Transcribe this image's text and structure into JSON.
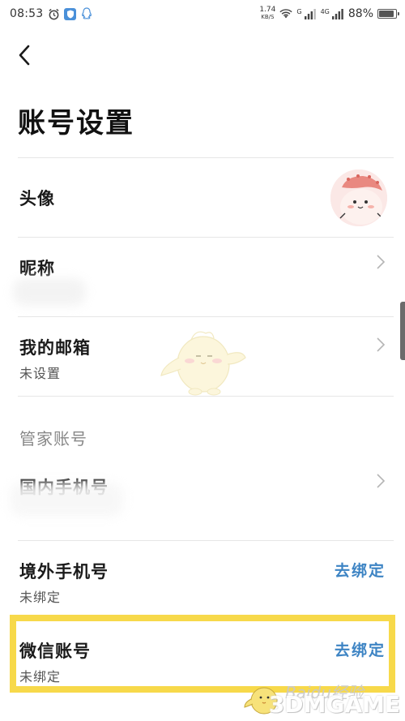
{
  "status_bar": {
    "time": "08:53",
    "net_speed_value": "1.74",
    "net_speed_unit": "KB/S",
    "signal1_label": "G",
    "signal2_label": "4G",
    "battery_percent": "88%",
    "battery_level": 0.88
  },
  "page": {
    "title": "账号设置"
  },
  "rows": {
    "avatar": {
      "title": "头像"
    },
    "nickname": {
      "title": "昵称"
    },
    "email": {
      "title": "我的邮箱",
      "subtitle": "未设置"
    },
    "section_label": "管家账号",
    "domestic_phone": {
      "title": "国内手机号"
    },
    "overseas_phone": {
      "title": "境外手机号",
      "subtitle": "未绑定",
      "action": "去绑定"
    },
    "wechat": {
      "title": "微信账号",
      "subtitle": "未绑定",
      "action": "去绑定"
    }
  },
  "watermark": {
    "baidu": "Baidu经验",
    "brand": "3DMGAME"
  },
  "colors": {
    "accent_link": "#3d84c4",
    "highlight": "#f7d94a"
  }
}
